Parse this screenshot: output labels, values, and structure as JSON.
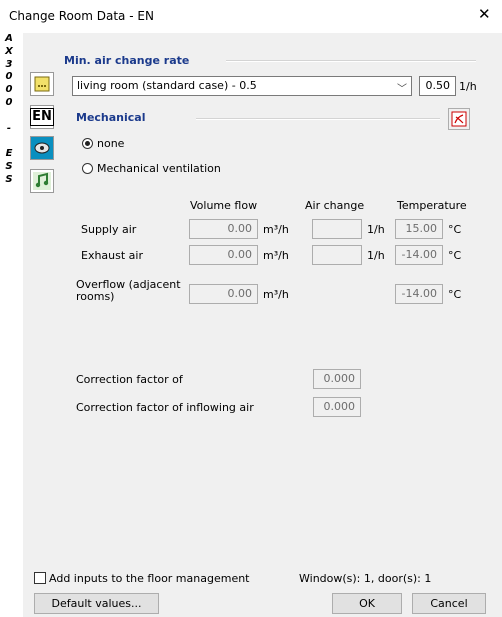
{
  "window": {
    "title": "Change Room Data - EN",
    "close_icon": "close-icon"
  },
  "sidebar": {
    "vertical_label": "AX3000 - ESS",
    "letters": [
      "A",
      "X",
      "3",
      "0",
      "0",
      "0",
      "",
      "-",
      "",
      "E",
      "S",
      "S"
    ]
  },
  "toolbar": {
    "icons": [
      "room-data-icon",
      "language-en-icon",
      "ventilation-icon",
      "music-icon"
    ],
    "en_label": "EN"
  },
  "air_change": {
    "section_title": "Min. air change rate",
    "selected": "living room (standard case) - 0.5",
    "rate_value": "0.50",
    "rate_unit": "1/h"
  },
  "mechanical": {
    "section_title": "Mechanical",
    "options": [
      "none",
      "Mechanical ventilation"
    ],
    "selected_index": 0
  },
  "table": {
    "columns": [
      "Volume flow",
      "Air change",
      "Temperature"
    ],
    "rows": [
      {
        "label": "Supply air",
        "volume": "0.00",
        "volume_unit": "m³/h",
        "air_change": "",
        "air_change_unit": "1/h",
        "temp": "15.00",
        "temp_unit": "°C"
      },
      {
        "label": "Exhaust air",
        "volume": "0.00",
        "volume_unit": "m³/h",
        "air_change": "",
        "air_change_unit": "1/h",
        "temp": "-14.00",
        "temp_unit": "°C"
      },
      {
        "label": "Overflow (adjacent rooms)",
        "volume": "0.00",
        "volume_unit": "m³/h",
        "temp": "-14.00",
        "temp_unit": "°C"
      }
    ],
    "overflow_label_lines": [
      "Overflow (adjacent",
      "rooms)"
    ]
  },
  "correction": {
    "factor_label": "Correction factor of",
    "factor_value": "0.000",
    "inflow_label": "Correction factor of inflowing air",
    "inflow_value": "0.000"
  },
  "footer": {
    "checkbox_label": "Add inputs to the floor management",
    "checkbox_checked": false,
    "status": "Window(s): 1, door(s): 1",
    "default_button": "Default values...",
    "ok_button": "OK",
    "cancel_button": "Cancel"
  }
}
